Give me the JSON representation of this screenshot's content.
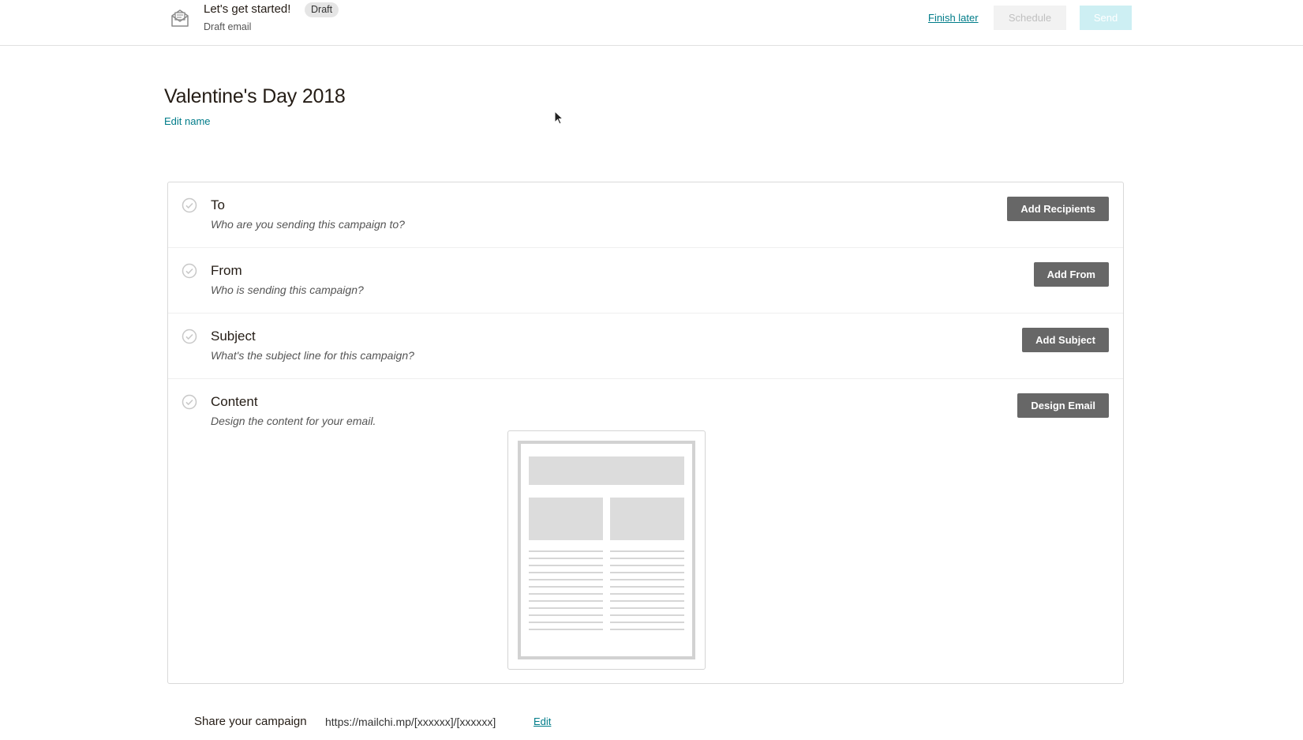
{
  "header": {
    "title": "Let's get started!",
    "status_badge": "Draft",
    "subtitle": "Draft email",
    "finish_later": "Finish later",
    "schedule": "Schedule",
    "send": "Send"
  },
  "campaign": {
    "name": "Valentine's Day 2018",
    "edit_name": "Edit name"
  },
  "checklist": [
    {
      "title": "To",
      "description": "Who are you sending this campaign to?",
      "button": "Add Recipients"
    },
    {
      "title": "From",
      "description": "Who is sending this campaign?",
      "button": "Add From"
    },
    {
      "title": "Subject",
      "description": "What's the subject line for this campaign?",
      "button": "Add Subject"
    },
    {
      "title": "Content",
      "description": "Design the content for your email.",
      "button": "Design Email"
    }
  ],
  "share": {
    "label": "Share your campaign",
    "url": "https://mailchi.mp/[xxxxxx]/[xxxxxx]",
    "edit": "Edit"
  },
  "icons": {
    "header_icon": "email-envelope-icon",
    "row_check": "check-circle-icon",
    "cursor": "mouse-cursor-icon"
  },
  "colors": {
    "link": "#007c89",
    "primary_button": "#676767",
    "send_disabled": "#cdeff3"
  }
}
